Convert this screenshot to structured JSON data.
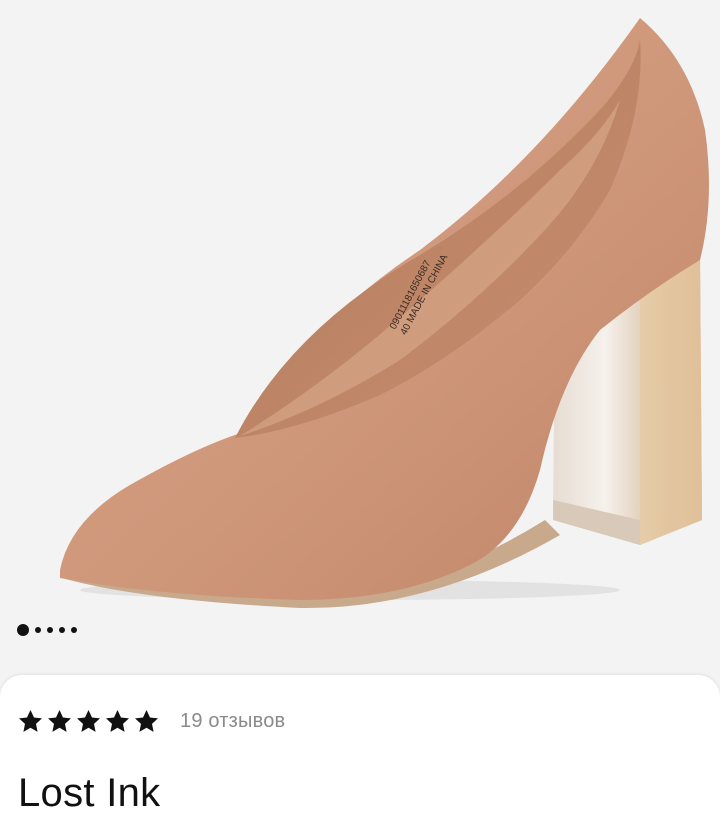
{
  "gallery": {
    "image_alt": "Туфли",
    "inner_label_line1": "09011181650687",
    "inner_label_line2": "40 MADE IN CHINA",
    "slide_count": 5,
    "active_slide": 1
  },
  "product": {
    "rating_stars": 5,
    "reviews_label": "19 отзывов",
    "brand_title": "Lost Ink"
  },
  "colors": {
    "suede": "#d29b7e",
    "star": "#111111"
  }
}
